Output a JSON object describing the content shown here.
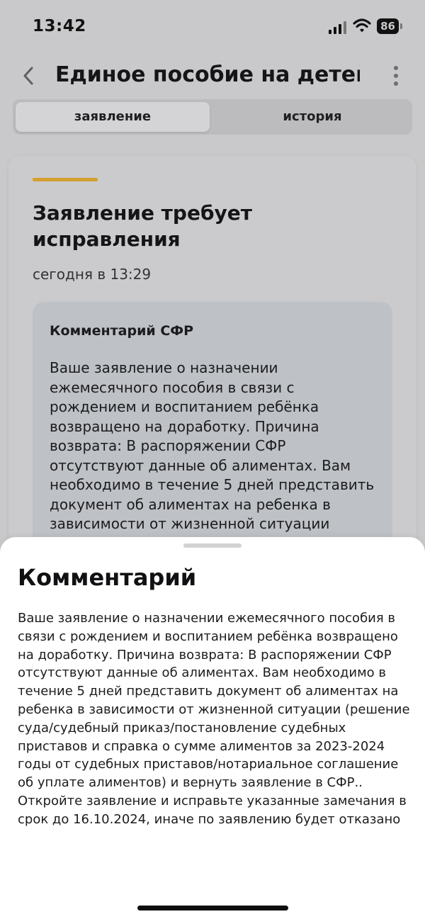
{
  "status_bar": {
    "time": "13:42",
    "battery": "86"
  },
  "header": {
    "title": "Единое пособие на детей..."
  },
  "tabs": [
    {
      "label": "заявление",
      "selected": true
    },
    {
      "label": "история",
      "selected": false
    }
  ],
  "card": {
    "title": "Заявление требует исправления",
    "date": "сегодня в 13:29",
    "accent_color": "#d4a02f",
    "comment": {
      "heading": "Комментарий СФР",
      "text": "Ваше заявление о назначении ежемесячного пособия в связи с рождением и воспитанием ребёнка возвращено на доработку. Причина возврата: В распоряжении СФР отсутствуют данные об алиментах. Вам необходимо в течение 5 дней представить документ об алиментах на ребенка в зависимости от жизненной ситуации"
    }
  },
  "sheet": {
    "title": "Комментарий",
    "text": "Ваше заявление о назначении ежемесячного пособия в связи с рождением и воспитанием ребёнка возвращено на доработку. Причина возврата: В распоряжении СФР отсутствуют данные об алиментах. Вам необходимо в течение 5 дней представить документ об алиментах на ребенка в зависимости от жизненной ситуации (решение суда/судебный приказ/постановление судебных приставов и справка о сумме алиментов за 2023-2024 годы от судебных приставов/нотариальное соглашение об уплате алиментов) и вернуть заявление в СФР.. Откройте заявление и исправьте указанные замечания в срок до 16.10.2024, иначе по заявлению будет отказано"
  }
}
